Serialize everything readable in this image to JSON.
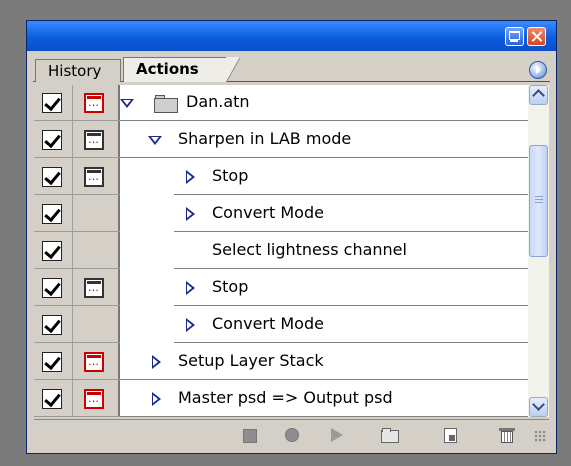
{
  "tabs": [
    {
      "label": "History",
      "active": false
    },
    {
      "label": "Actions",
      "active": true
    }
  ],
  "rows": [
    {
      "label": "Dan.atn",
      "checked": true,
      "dialog": "red",
      "expander": "expanded",
      "level": 0,
      "is_set": true
    },
    {
      "label": "Sharpen in LAB mode",
      "checked": true,
      "dialog": "dark",
      "expander": "expanded",
      "level": 1
    },
    {
      "label": "Stop",
      "checked": true,
      "dialog": "dark",
      "expander": "collapsed",
      "level": 2
    },
    {
      "label": "Convert Mode",
      "checked": true,
      "dialog": "none",
      "expander": "collapsed",
      "level": 2
    },
    {
      "label": "Select lightness channel",
      "checked": true,
      "dialog": "none",
      "expander": "none",
      "level": 2
    },
    {
      "label": "Stop",
      "checked": true,
      "dialog": "dark",
      "expander": "collapsed",
      "level": 2
    },
    {
      "label": "Convert Mode",
      "checked": true,
      "dialog": "none",
      "expander": "collapsed",
      "level": 2
    },
    {
      "label": "Setup Layer Stack",
      "checked": true,
      "dialog": "red",
      "expander": "collapsed",
      "level": 1
    },
    {
      "label": "Master psd => Output psd",
      "checked": true,
      "dialog": "red",
      "expander": "collapsed",
      "level": 1
    }
  ],
  "footer_buttons": [
    "stop-icon",
    "record-icon",
    "play-icon",
    "folder-icon",
    "new-action-icon",
    "trash-icon"
  ],
  "colors": {
    "title_bar": "#0a5fe0",
    "dialog_red": "#cc0000",
    "panel_bg": "#d4d0c8",
    "expander": "#1a2a8a"
  }
}
